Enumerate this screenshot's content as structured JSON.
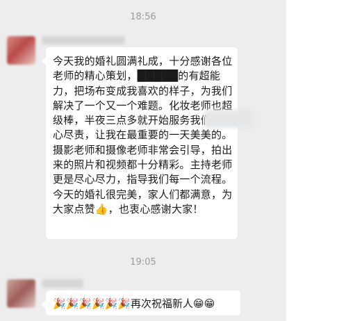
{
  "chat": {
    "timestamp1": "18:56",
    "message1": "今天我的婚礼圆满礼成，十分感谢各位老师的精心策划，█████的有超能力，把场布变成我喜欢的样子，为我们解决了一个又一个难题。化妆老师也超级棒，半夜三点多就开始服务我们，尽心尽责，让我在最重要的一天美美的。摄影老师和摄像老师非常会引导，拍出来的照片和视频都十分精彩。主持老师更是尽心尽力，指导我们每一个流程。今天的婚礼很完美，家人们都满意，为大家点赞👍，也衷心感谢大家！",
    "timestamp2": "19:05",
    "message2": "🎉🎉🎉🎉🎉🎉再次祝福新人😁😁"
  },
  "colors": {
    "chat_background": "#ededed",
    "bubble": "#ffffff",
    "text": "#1a1a1a",
    "timestamp": "#9b9b9b"
  }
}
